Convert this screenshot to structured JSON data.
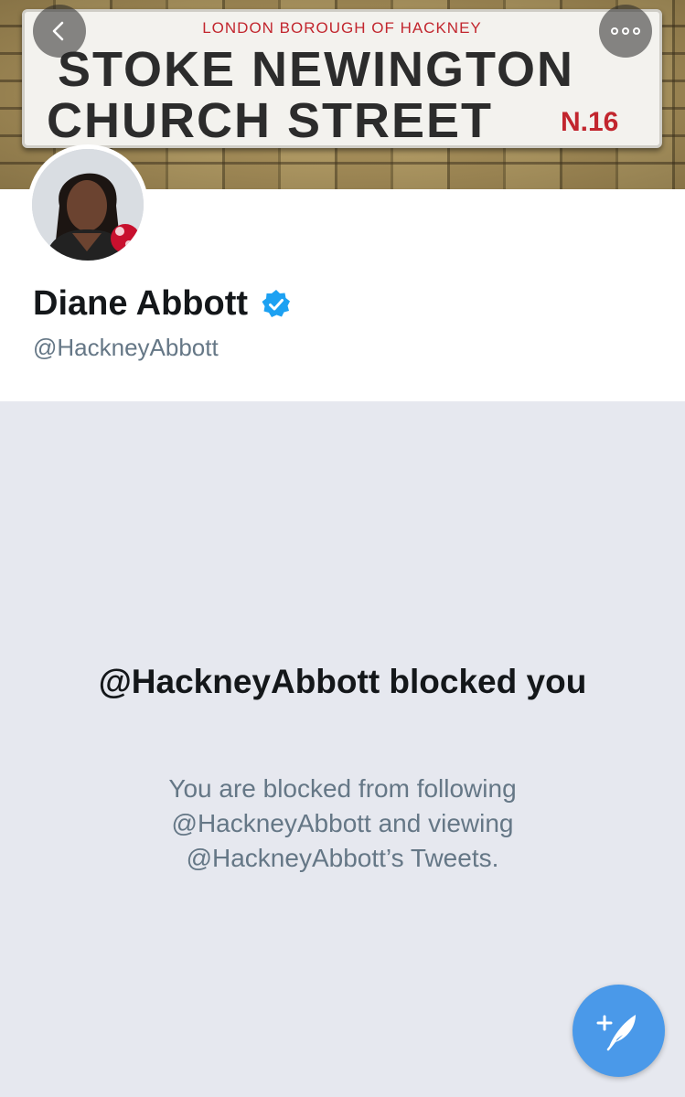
{
  "banner": {
    "sign_top": "LONDON BOROUGH OF HACKNEY",
    "sign_line1": "STOKE NEWINGTON",
    "sign_line2": "CHURCH STREET",
    "sign_code": "N.16"
  },
  "nav": {
    "back_icon": "chevron-left-icon",
    "more_icon": "more-horizontal-icon"
  },
  "profile": {
    "name": "Diane Abbott",
    "handle": "@HackneyAbbott",
    "verified_icon": "verified-badge-icon",
    "verified_color": "#1da1f2"
  },
  "blocked": {
    "title": "@HackneyAbbott blocked you",
    "description": "You are blocked from following @HackneyAbbott and viewing @HackneyAbbott’s Tweets."
  },
  "compose": {
    "icon": "compose-tweet-icon",
    "color": "#4a99e9"
  }
}
